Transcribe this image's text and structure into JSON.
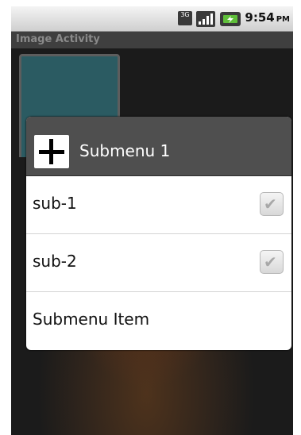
{
  "status_bar": {
    "network_icon": "3g-icon",
    "network_label": "3G",
    "signal_icon": "signal-bars-icon",
    "battery_icon": "battery-charging-icon",
    "time": "9:54",
    "ampm": "PM"
  },
  "app": {
    "title": "Image Activity"
  },
  "dialog": {
    "icon": "plus-icon",
    "title": "Submenu 1",
    "items": [
      {
        "label": "sub-1",
        "checked": true
      },
      {
        "label": "sub-2",
        "checked": true
      },
      {
        "label": "Submenu Item"
      }
    ]
  },
  "colors": {
    "dialog_header": "#4f4f4f",
    "title_bar": "#3f3f3f",
    "thumbnail": "#2b5b62"
  }
}
